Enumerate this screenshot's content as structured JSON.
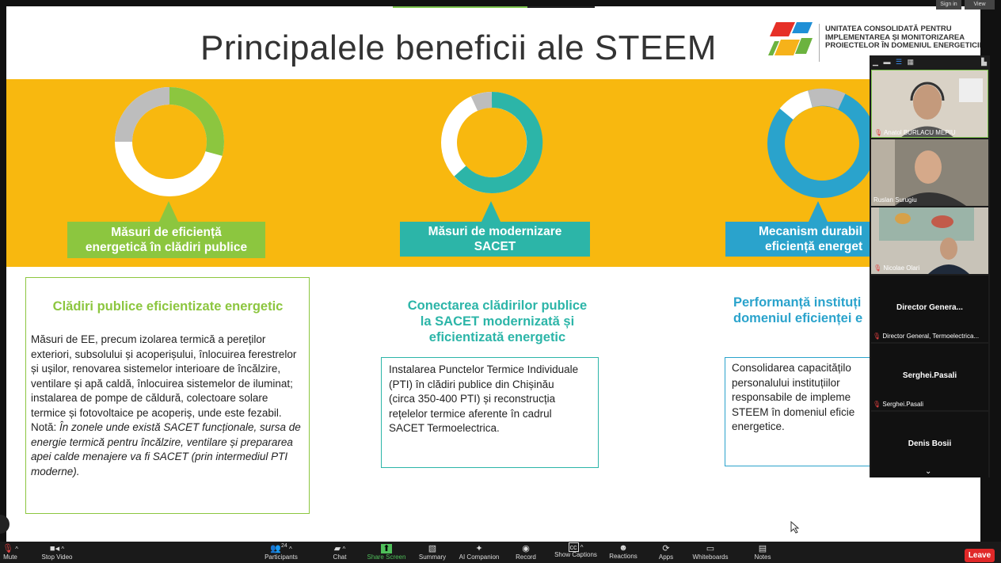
{
  "slide": {
    "title": "Principalele beneficii ale STEEM",
    "logo_text": [
      "UNITATEA CONSOLIDATĂ PENTRU",
      "IMPLEMENTAREA ȘI MONITORIZAREA",
      "PROIECTELOR ÎN DOMENIUL ENERGETICII"
    ],
    "columns": [
      {
        "pill": [
          "Măsuri de eficiență",
          "energetică în clădiri publice"
        ],
        "heading": [
          "Clădiri publice eficientizate energetic"
        ],
        "body": "Măsuri de EE,  precum  izolarea termică a pereților  exteriori, subsolului și acoperișului, înlocuirea ferestrelor și ușilor, renovarea sistemelor interioare de încălzire, ventilare și apă caldă, înlocuirea sistemelor de iluminat; instalarea de pompe de căldură, colectoare solare termice și fotovoltaice pe acoperiș, unde este fezabil.",
        "note_label": "Notă:",
        "note": "În zonele unde există SACET funcționale, sursa de energie termică pentru încălzire, ventilare și prepararea apei calde menajere va fi SACET (prin intermediul PTI moderne).",
        "accent": "#8cc63f"
      },
      {
        "pill": [
          "Măsuri de modernizare",
          "SACET"
        ],
        "heading": [
          "Conectarea clădirilor publice",
          "la SACET modernizată și",
          "eficientizată energetic"
        ],
        "body": "Instalarea Punctelor Termice Individuale (PTI) în clădiri publice din Chișinău (circa 350-400 PTI) și reconstrucția rețelelor termice aferente în cadrul SACET Termoelectrica.",
        "accent": "#2cb5a8"
      },
      {
        "pill": [
          "Mecanism durabil",
          "eficiență energet"
        ],
        "heading": [
          "Performanță instituți",
          "domeniul eficienței e"
        ],
        "body": "Consolidarea capacitățilo personalului instituțiilor responsabile de impleme STEEM în domeniul eficie energetice.",
        "accent": "#2aa3cc"
      }
    ]
  },
  "participants": [
    {
      "name": "Anatol BURLACU MEPIU",
      "muted": true
    },
    {
      "name": "Ruslan Surugiu",
      "muted": false
    },
    {
      "name": "Nicolae Olari",
      "muted": true
    },
    {
      "display": "Director Genera...",
      "name": "Director General, Termoelectrica...",
      "muted": true
    },
    {
      "display": "Serghei.Pasali",
      "name": "Serghei.Pasali",
      "muted": true
    },
    {
      "display": "Denis Bosii",
      "name": "Denis Bosii",
      "muted": true
    }
  ],
  "toolbar": {
    "items": [
      "Mute",
      "Stop Video",
      "Participants",
      "Chat",
      "Share Screen",
      "Summary",
      "AI Companion",
      "Record",
      "Show Captions",
      "Reactions",
      "Apps",
      "Whiteboards",
      "Notes"
    ],
    "participant_count": "24",
    "leave": "Leave"
  },
  "top_right": {
    "sign_in": "Sign in",
    "view": "View"
  },
  "colors": {
    "band": "#f8b80f",
    "green": "#8cc63f",
    "teal": "#2cb5a8",
    "blue": "#2aa3cc",
    "leave": "#e02828"
  }
}
